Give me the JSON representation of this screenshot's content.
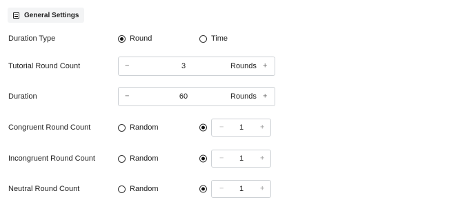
{
  "header": {
    "title": "General Settings",
    "icon": "settings-section-icon"
  },
  "duration_type": {
    "label": "Duration Type",
    "options": [
      {
        "label": "Round",
        "checked": true
      },
      {
        "label": "Time",
        "checked": false
      }
    ]
  },
  "tutorial_round_count": {
    "label": "Tutorial Round Count",
    "minus": "−",
    "value": "3",
    "unit": "Rounds",
    "plus": "+"
  },
  "duration": {
    "label": "Duration",
    "minus": "−",
    "value": "60",
    "unit": "Rounds",
    "plus": "+"
  },
  "congruent": {
    "label": "Congruent Round Count",
    "random_label": "Random",
    "random_checked": false,
    "fixed_checked": true,
    "minus": "−",
    "value": "1",
    "plus": "+"
  },
  "incongruent": {
    "label": "Incongruent Round Count",
    "random_label": "Random",
    "random_checked": false,
    "fixed_checked": true,
    "minus": "−",
    "value": "1",
    "plus": "+"
  },
  "neutral": {
    "label": "Neutral Round Count",
    "random_label": "Random",
    "random_checked": false,
    "fixed_checked": true,
    "minus": "−",
    "value": "1",
    "plus": "+"
  }
}
